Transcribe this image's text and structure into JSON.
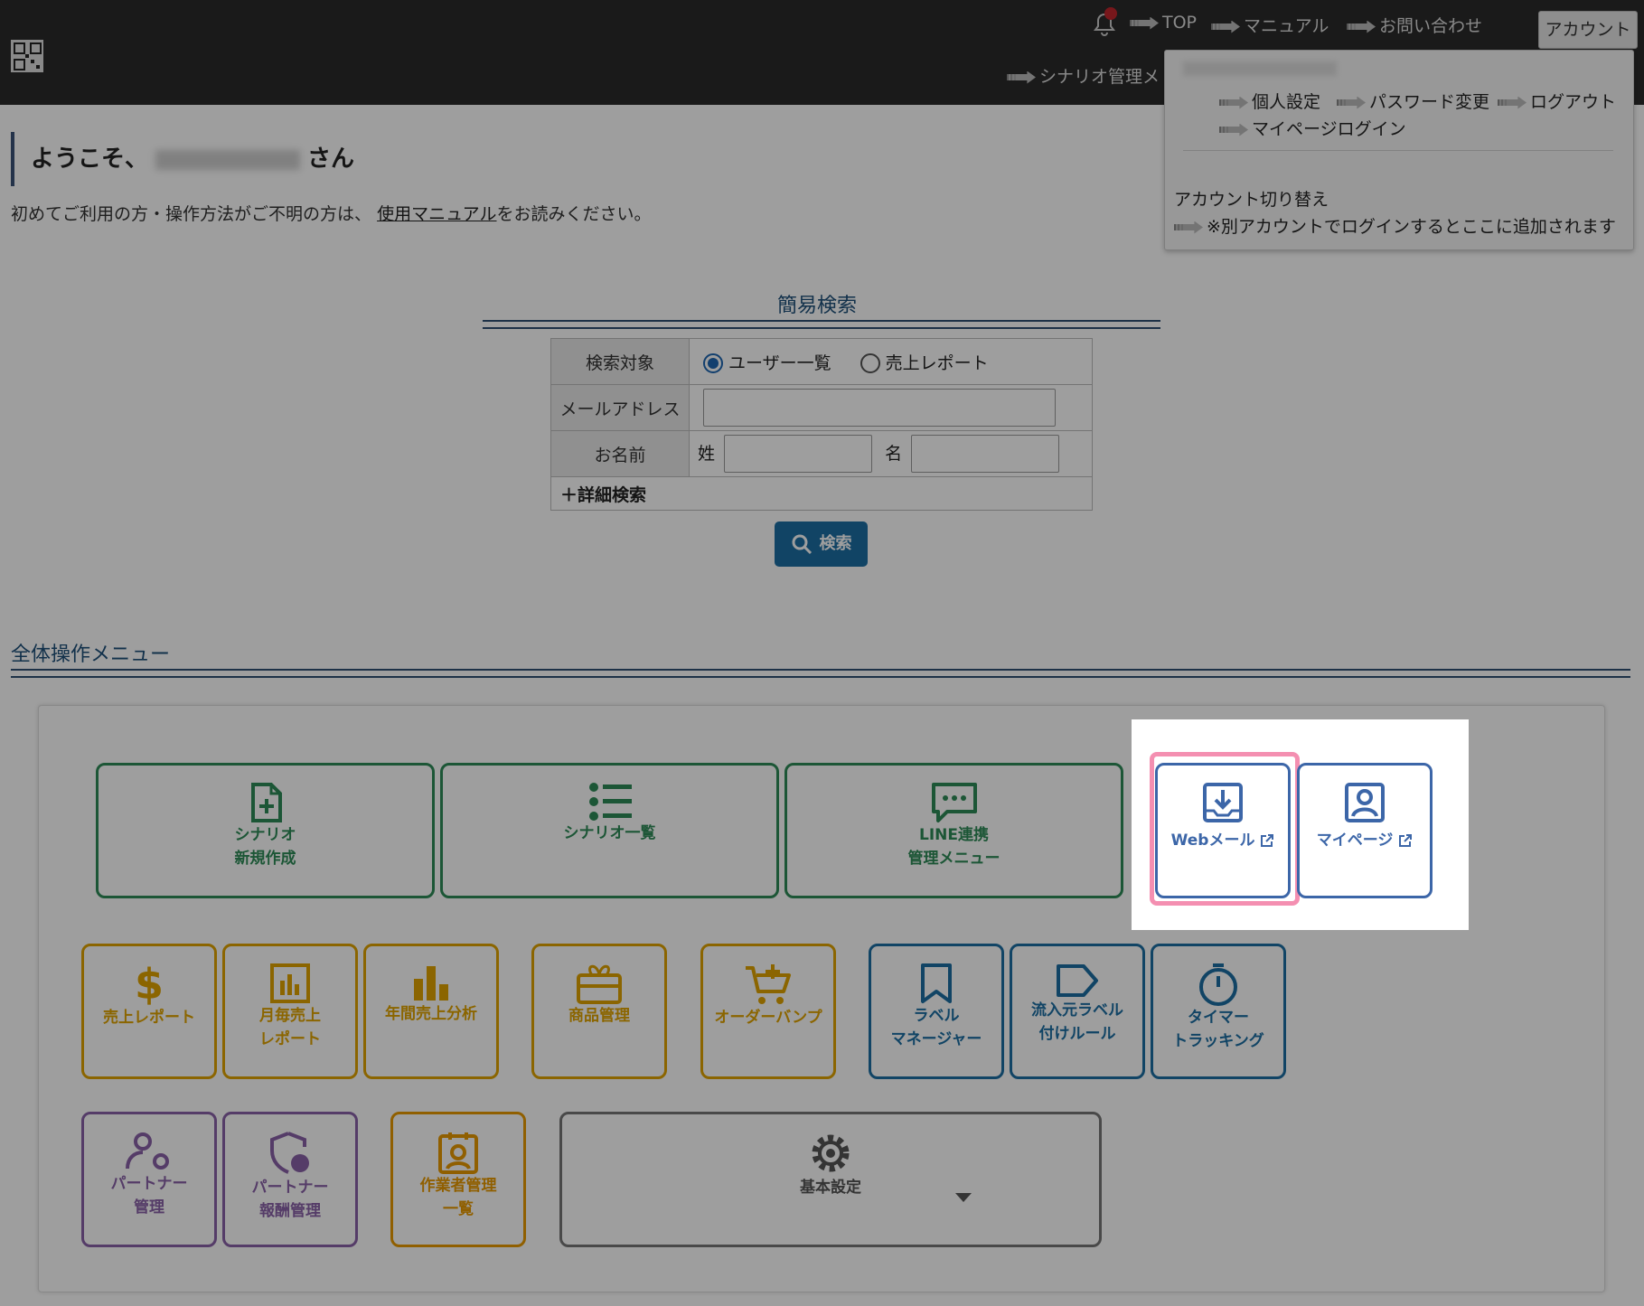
{
  "header": {
    "nav": [
      {
        "label": "TOP"
      },
      {
        "label": "マニュアル"
      },
      {
        "label": "お問い合わせ"
      }
    ],
    "account_label": "アカウント",
    "scenario_menu_label": "シナリオ管理メ"
  },
  "dropdown": {
    "items": [
      "個人設定",
      "パスワード変更",
      "ログアウト",
      "マイページログイン"
    ],
    "switch_title": "アカウント切り替え",
    "switch_note": "※別アカウントでログインするとここに追加されます"
  },
  "welcome": {
    "prefix": "ようこそ、",
    "suffix": "さん",
    "intro_before": "初めてご利用の方・操作方法がご不明の方は、",
    "manual_link": "使用マニュアル",
    "intro_after": "をお読みください。"
  },
  "search": {
    "title": "簡易検索",
    "target_label": "検索対象",
    "option_users": "ユーザー一覧",
    "option_sales": "売上レポート",
    "email_label": "メールアドレス",
    "name_label": "お名前",
    "last_name": "姓",
    "first_name": "名",
    "advanced": "＋詳細検索",
    "button": "検索"
  },
  "menu": {
    "title": "全体操作メニュー",
    "tiles": {
      "scenario_new": [
        "シナリオ",
        "新規作成"
      ],
      "scenario_list": [
        "シナリオ一覧"
      ],
      "line": [
        "LINE連携",
        "管理メニュー"
      ],
      "webmail": [
        "Webメール"
      ],
      "mypage": [
        "マイページ"
      ],
      "sales_report": [
        "売上レポート"
      ],
      "monthly": [
        "月毎売上",
        "レポート"
      ],
      "annual": [
        "年間売上分析"
      ],
      "products": [
        "商品管理"
      ],
      "orderbump": [
        "オーダーバンプ"
      ],
      "label_manager": [
        "ラベル",
        "マネージャー"
      ],
      "inflow_label": [
        "流入元ラベル",
        "付けルール"
      ],
      "timer": [
        "タイマー",
        "トラッキング"
      ],
      "partner": [
        "パートナー",
        "管理"
      ],
      "partner_reward": [
        "パートナー",
        "報酬管理"
      ],
      "worker": [
        "作業者管理",
        "一覧"
      ],
      "basic": [
        "基本設定"
      ]
    }
  }
}
